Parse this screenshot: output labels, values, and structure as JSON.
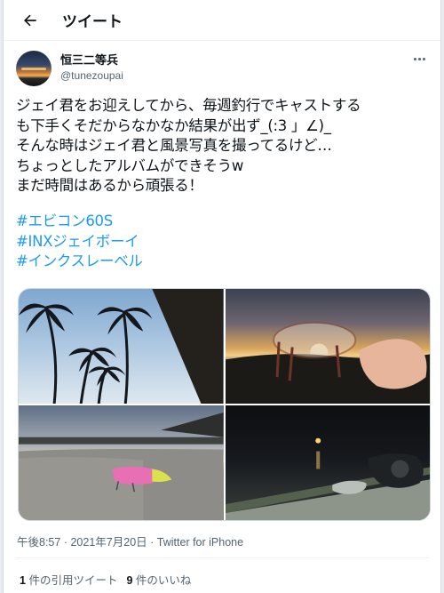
{
  "header": {
    "title": "ツイート",
    "back_icon": "arrow-left-icon"
  },
  "author": {
    "display_name": "恒三二等兵",
    "handle": "@tunezoupai",
    "more_icon": "more-horizontal-icon"
  },
  "tweet": {
    "lines": [
      "ジェイ君をお迎えしてから、毎週釣行でキャストする",
      "も下手くそだからなかなか結果が出ず_(:3 」∠)_",
      "そんな時はジェイ君と風景写真を撮ってるけど…",
      "ちょっとしたアルバムができそうw",
      "まだ時間はあるから頑張る！"
    ],
    "hashtags": [
      "#エビコン60S",
      "#INXジェイボーイ",
      "#インクスレーベル"
    ]
  },
  "meta": {
    "time": "午後8:57",
    "separator": "·",
    "date": "2021年7月20日",
    "source": "Twitter for iPhone"
  },
  "stats": {
    "quote_count": "1",
    "quote_label": "件の引用ツイート",
    "like_count": "9",
    "like_label": "件のいいね"
  },
  "colors": {
    "accent": "#1d9bf0",
    "text": "#0f1419",
    "secondary": "#536471"
  }
}
